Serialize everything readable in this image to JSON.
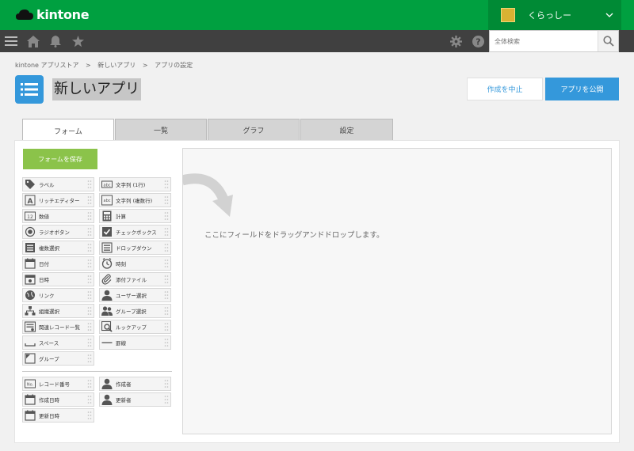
{
  "header": {
    "logo_text": "kintone",
    "user_name": "くらっしー"
  },
  "search": {
    "placeholder": "全体検索"
  },
  "breadcrumb": [
    "kintone アプリストア",
    ">",
    "新しいアプリ",
    ">",
    "アプリの設定"
  ],
  "app": {
    "title": "新しいアプリ"
  },
  "buttons": {
    "cancel": "作成を中止",
    "publish": "アプリを公開",
    "save_form": "フォームを保存"
  },
  "tabs": [
    "フォーム",
    "一覧",
    "グラフ",
    "設定"
  ],
  "fields_left": [
    {
      "label": "ラベル",
      "icon": "tag-icon"
    },
    {
      "label": "リッチエディター",
      "icon": "rich-editor-icon"
    },
    {
      "label": "数値",
      "icon": "number-icon"
    },
    {
      "label": "ラジオボタン",
      "icon": "radio-icon"
    },
    {
      "label": "複数選択",
      "icon": "multi-select-icon"
    },
    {
      "label": "日付",
      "icon": "calendar-icon"
    },
    {
      "label": "日時",
      "icon": "datetime-icon"
    },
    {
      "label": "リンク",
      "icon": "globe-icon"
    },
    {
      "label": "組織選択",
      "icon": "org-icon"
    },
    {
      "label": "関連レコード一覧",
      "icon": "related-records-icon"
    },
    {
      "label": "スペース",
      "icon": "space-icon"
    },
    {
      "label": "グループ",
      "icon": "group-icon"
    }
  ],
  "fields_right": [
    {
      "label": "文字列 (1行)",
      "icon": "text-line-icon"
    },
    {
      "label": "文字列 (複数行)",
      "icon": "text-multiline-icon"
    },
    {
      "label": "計算",
      "icon": "calculator-icon"
    },
    {
      "label": "チェックボックス",
      "icon": "checkbox-icon"
    },
    {
      "label": "ドロップダウン",
      "icon": "dropdown-icon"
    },
    {
      "label": "時刻",
      "icon": "clock-icon"
    },
    {
      "label": "添付ファイル",
      "icon": "attachment-icon"
    },
    {
      "label": "ユーザー選択",
      "icon": "user-icon"
    },
    {
      "label": "グループ選択",
      "icon": "users-icon"
    },
    {
      "label": "ルックアップ",
      "icon": "lookup-icon"
    },
    {
      "label": "罫線",
      "icon": "line-icon"
    }
  ],
  "system_fields_left": [
    {
      "label": "レコード番号",
      "icon": "record-number-icon"
    },
    {
      "label": "作成日時",
      "icon": "calendar-icon"
    },
    {
      "label": "更新日時",
      "icon": "calendar-icon"
    }
  ],
  "system_fields_right": [
    {
      "label": "作成者",
      "icon": "user-icon"
    },
    {
      "label": "更新者",
      "icon": "user-icon"
    }
  ],
  "dropzone": {
    "message": "ここにフィールドをドラッグアンドドロップします。"
  },
  "colors": {
    "header_green": "#00a040",
    "nav_dark": "#404040",
    "accent_blue": "#3498db",
    "save_green": "#8bc34a"
  }
}
